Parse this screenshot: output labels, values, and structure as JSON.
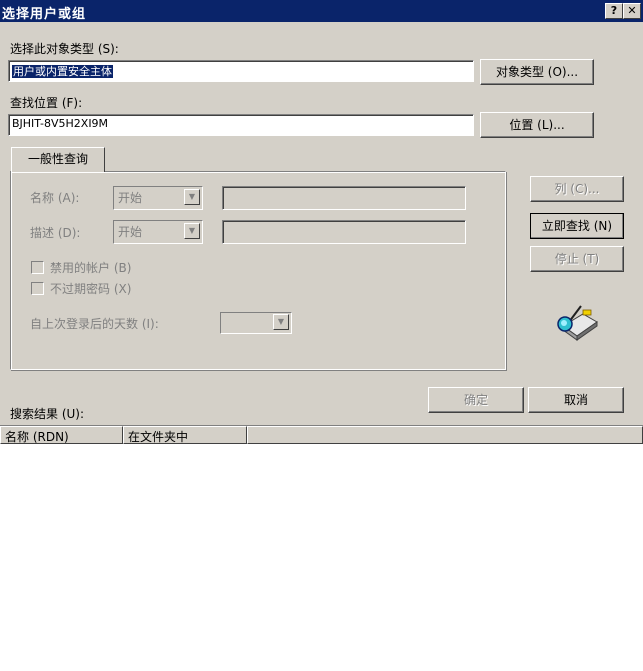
{
  "window": {
    "title": "选择用户或组",
    "help_glyph": "?",
    "close_glyph": "✕"
  },
  "object_type": {
    "label": "选择此对象类型 (S):",
    "value": "用户或内置安全主体",
    "button": "对象类型 (O)..."
  },
  "location": {
    "label": "查找位置 (F):",
    "value": "BJHIT-8V5H2XI9M",
    "button": "位置 (L)..."
  },
  "query": {
    "tab": "一般性查询",
    "name_label": "名称 (A):",
    "name_mode": "开始",
    "desc_label": "描述 (D):",
    "desc_mode": "开始",
    "disabled_accounts": "禁用的帐户 (B)",
    "non_expiring_passwords": "不过期密码 (X)",
    "days_since_logon_label": "自上次登录后的天数 (I):"
  },
  "side_buttons": {
    "columns": "列 (C)...",
    "find_now": "立即查找 (N)",
    "stop": "停止 (T)"
  },
  "dialog_buttons": {
    "ok": "确定",
    "cancel": "取消"
  },
  "results": {
    "label": "搜索结果 (U):",
    "columns": [
      "名称 (RDN)",
      "在文件夹中"
    ]
  }
}
